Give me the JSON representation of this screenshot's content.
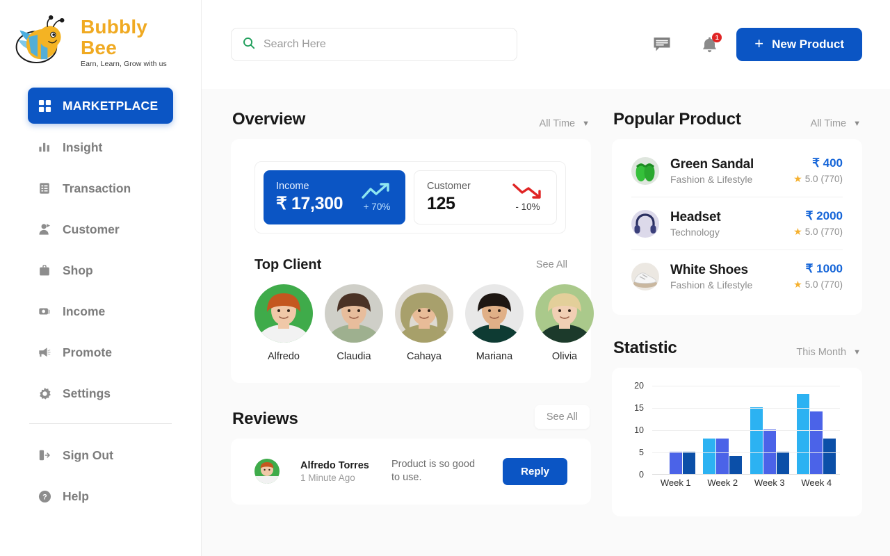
{
  "brand": {
    "name": "Bubbly Bee",
    "tagline": "Earn, Learn, Grow with us"
  },
  "sidebar": {
    "items": [
      {
        "label": "MARKETPLACE",
        "icon": "grid-icon",
        "active": true
      },
      {
        "label": "Insight",
        "icon": "chart-bar-icon",
        "active": false
      },
      {
        "label": "Transaction",
        "icon": "list-document-icon",
        "active": false
      },
      {
        "label": "Customer",
        "icon": "user-badge-icon",
        "active": false
      },
      {
        "label": "Shop",
        "icon": "briefcase-icon",
        "active": false
      },
      {
        "label": "Income",
        "icon": "money-icon",
        "active": false
      },
      {
        "label": "Promote",
        "icon": "megaphone-icon",
        "active": false
      },
      {
        "label": "Settings",
        "icon": "gear-icon",
        "active": false
      }
    ],
    "footer_items": [
      {
        "label": "Sign Out",
        "icon": "sign-out-icon"
      },
      {
        "label": "Help",
        "icon": "help-circle-icon"
      }
    ]
  },
  "topbar": {
    "search_placeholder": "Search Here",
    "search_value": "",
    "search_icon": "search-icon",
    "message_icon": "message-icon",
    "notification_icon": "bell-icon",
    "notification_count": "1",
    "new_product_label": "New Product",
    "new_product_plus": "+"
  },
  "overview": {
    "title": "Overview",
    "filter": "All Time",
    "kpis": [
      {
        "label": "Income",
        "value": "₹ 17,300",
        "delta": "+ 70%",
        "trend": "up",
        "highlight": true
      },
      {
        "label": "Customer",
        "value": "125",
        "delta": "- 10%",
        "trend": "down",
        "highlight": false
      }
    ]
  },
  "top_client": {
    "title": "Top Client",
    "see_all": "See All",
    "clients": [
      {
        "name": "Alfredo",
        "bg": "#3fab4a",
        "skin": "#f0c8a8",
        "hair": "#c4571f",
        "shirt": "#f2f2f2"
      },
      {
        "name": "Claudia",
        "bg": "#cfcfc8",
        "skin": "#e7bd9c",
        "hair": "#4a3225",
        "shirt": "#9eb08f"
      },
      {
        "name": "Cahaya",
        "bg": "#dedad2",
        "skin": "#e8bc98",
        "hair": "#a8a06c",
        "shirt": "#a7a06a"
      },
      {
        "name": "Mariana",
        "bg": "#e8e8e8",
        "skin": "#e0b087",
        "hair": "#1d1612",
        "shirt": "#0e3b33"
      },
      {
        "name": "Olivia",
        "bg": "#aac98b",
        "skin": "#f1cfb4",
        "hair": "#e3cf9a",
        "shirt": "#1c3a2b"
      }
    ]
  },
  "reviews": {
    "title": "Reviews",
    "see_all": "See All",
    "items": [
      {
        "name": "Alfredo Torres",
        "time": "1 Minute Ago",
        "text": "Product is so good to use.",
        "reply_label": "Reply"
      }
    ]
  },
  "popular_product": {
    "title": "Popular Product",
    "filter": "All Time",
    "items": [
      {
        "name": "Green Sandal",
        "category": "Fashion & Lifestyle",
        "price": "₹ 400",
        "rating": "5.0",
        "reviews": "(770)",
        "thumb": "green-sandal"
      },
      {
        "name": "Headset",
        "category": "Technology",
        "price": "₹ 2000",
        "rating": "5.0",
        "reviews": "(770)",
        "thumb": "headset"
      },
      {
        "name": "White Shoes",
        "category": "Fashion & Lifestyle",
        "price": "₹ 1000",
        "rating": "5.0",
        "reviews": "(770)",
        "thumb": "white-shoes"
      }
    ]
  },
  "statistic": {
    "title": "Statistic",
    "filter": "This Month"
  },
  "chart_data": {
    "type": "bar",
    "title": "Statistic",
    "categories": [
      "Week 1",
      "Week 2",
      "Week 3",
      "Week 4"
    ],
    "series": [
      {
        "name": "Series 1",
        "color": "#2CB2F2",
        "values": [
          0,
          8,
          15,
          18
        ]
      },
      {
        "name": "Series 2",
        "color": "#4B63E8",
        "values": [
          5,
          8,
          10,
          14
        ]
      },
      {
        "name": "Series 3",
        "color": "#0B4FA8",
        "values": [
          5,
          4,
          5,
          8
        ]
      }
    ],
    "yticks": [
      0,
      5,
      10,
      15,
      20
    ],
    "ylim": [
      0,
      20
    ],
    "xlabel": "",
    "ylabel": "",
    "grid": true,
    "legend": "none"
  },
  "colors": {
    "accent": "#0B55C4",
    "brand_yellow": "#f0aa22",
    "search_green": "#1e9e5a",
    "badge_red": "#e02424",
    "up_green": "#7fe3d0",
    "down_red": "#e02424"
  }
}
